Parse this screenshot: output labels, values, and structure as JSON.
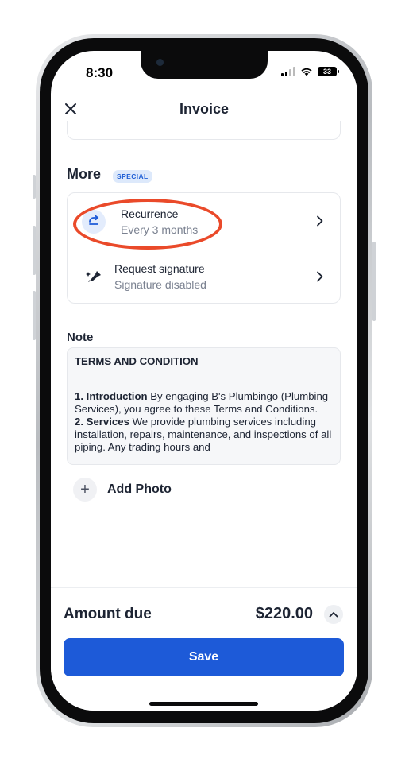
{
  "status_bar": {
    "time": "8:30",
    "battery": "33"
  },
  "header": {
    "title": "Invoice"
  },
  "more": {
    "title": "More",
    "badge": "SPECIAL",
    "items": [
      {
        "title": "Recurrence",
        "subtitle": "Every 3 months",
        "icon": "repeat-icon"
      },
      {
        "title": "Request signature",
        "subtitle": "Signature disabled",
        "icon": "signature-pen-icon"
      }
    ]
  },
  "note": {
    "label": "Note",
    "heading": "TERMS AND CONDITION",
    "sections": [
      {
        "title": "1. Introduction",
        "body": " By engaging B's Plumbingo (Plumbing Services), you agree to these Terms and Conditions."
      },
      {
        "title": "2. Services",
        "body": " We provide plumbing services including installation, repairs, maintenance, and inspections of all piping. Any trading hours and"
      }
    ]
  },
  "add_photo": {
    "label": "Add Photo"
  },
  "footer": {
    "amount_label": "Amount due",
    "amount_value": "$220.00",
    "save_label": "Save"
  },
  "colors": {
    "accent": "#1d5ad8",
    "highlight_ring": "#ea4a2a",
    "badge_bg": "#dde9fb"
  }
}
